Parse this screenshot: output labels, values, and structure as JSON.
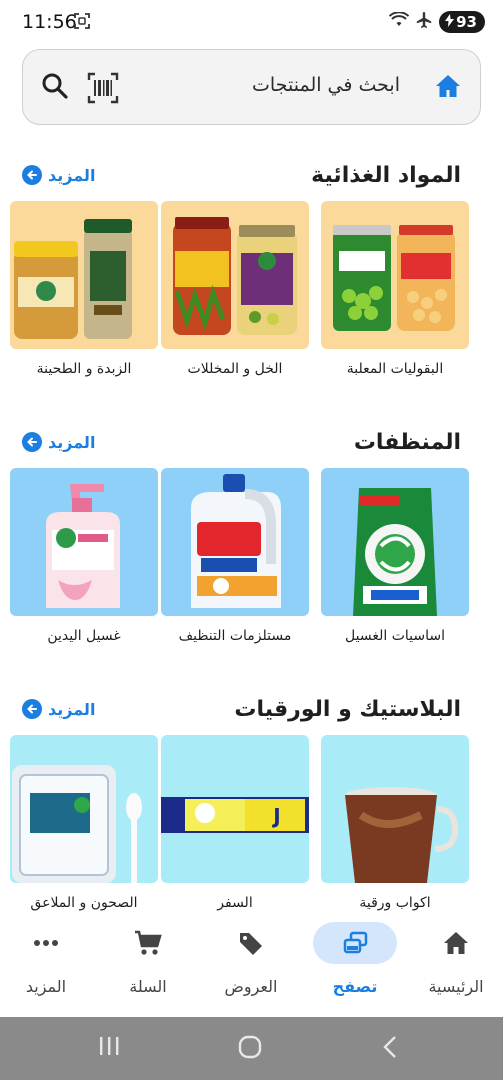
{
  "status": {
    "time": "11:56",
    "battery": "93"
  },
  "search": {
    "placeholder": "ابحث في المنتجات"
  },
  "sections": [
    {
      "title": "المواد الغذائية",
      "more": "المزيد",
      "items": [
        {
          "label": "البقوليات المعلبة",
          "bg": "#fbd99b"
        },
        {
          "label": "الخل و المخللات",
          "bg": "#fbd99b"
        },
        {
          "label": "الزبدة و الطحينة",
          "bg": "#fbd99b"
        }
      ]
    },
    {
      "title": "المنظفات",
      "more": "المزيد",
      "items": [
        {
          "label": "اساسيات الغسيل",
          "bg": "#8fd0f9"
        },
        {
          "label": "مستلزمات التنظيف",
          "bg": "#8fd0f9"
        },
        {
          "label": "غسيل اليدين",
          "bg": "#8fd0f9"
        }
      ]
    },
    {
      "title": "البلاستيك و الورقيات",
      "more": "المزيد",
      "items": [
        {
          "label": "اكواب ورقية",
          "bg": "#a9ecf7"
        },
        {
          "label": "السفر",
          "bg": "#a9ecf7"
        },
        {
          "label": "الصحون و الملاعق",
          "bg": "#a9ecf7"
        }
      ]
    }
  ],
  "bottom_nav": {
    "home": "الرئيسية",
    "browse": "تصفح",
    "offers": "العروض",
    "cart": "السلة",
    "more": "المزيد"
  },
  "colors": {
    "accent": "#1a7fe0",
    "active_pill": "#d3e6fb"
  }
}
